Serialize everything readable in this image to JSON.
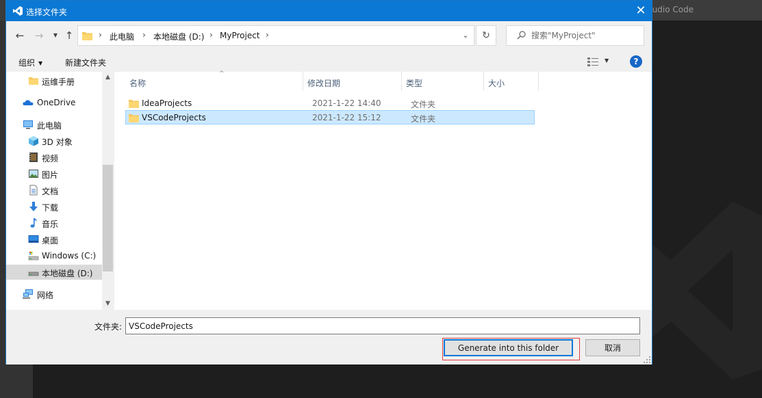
{
  "background_app": {
    "title_fragment": "tudio Code"
  },
  "dialog": {
    "title": "选择文件夹",
    "breadcrumb": [
      "此电脑",
      "本地磁盘 (D:)",
      "MyProject"
    ],
    "search_placeholder": "搜索\"MyProject\"",
    "toolbar": {
      "organize_label": "组织",
      "new_folder_label": "新建文件夹"
    },
    "nav_pane": {
      "items": [
        {
          "label": "运维手册",
          "icon": "folder-icon"
        },
        {
          "label": "OneDrive",
          "icon": "cloud-icon"
        },
        {
          "label": "此电脑",
          "icon": "computer-icon"
        },
        {
          "label": "3D 对象",
          "icon": "cube-icon"
        },
        {
          "label": "视频",
          "icon": "video-icon"
        },
        {
          "label": "图片",
          "icon": "picture-icon"
        },
        {
          "label": "文档",
          "icon": "document-icon"
        },
        {
          "label": "下载",
          "icon": "download-icon"
        },
        {
          "label": "音乐",
          "icon": "music-icon"
        },
        {
          "label": "桌面",
          "icon": "desktop-icon"
        },
        {
          "label": "Windows (C:)",
          "icon": "drive-icon"
        },
        {
          "label": "本地磁盘 (D:)",
          "icon": "drive-icon",
          "selected": true
        },
        {
          "label": "网络",
          "icon": "network-icon"
        }
      ]
    },
    "columns": {
      "name": "名称",
      "date": "修改日期",
      "type": "类型",
      "size": "大小"
    },
    "rows": [
      {
        "name": "IdeaProjects",
        "date": "2021-1-22 14:40",
        "type": "文件夹",
        "selected": false
      },
      {
        "name": "VSCodeProjects",
        "date": "2021-1-22 15:12",
        "type": "文件夹",
        "selected": true
      }
    ],
    "folder_label": "文件夹:",
    "folder_value": "VSCodeProjects",
    "primary_button": "Generate into this folder",
    "cancel_button": "取消"
  },
  "colors": {
    "titlebar": "#0a78d4",
    "selection": "#cce8ff",
    "highlight_box": "#e23b3b",
    "focus_border": "#0078d7"
  }
}
